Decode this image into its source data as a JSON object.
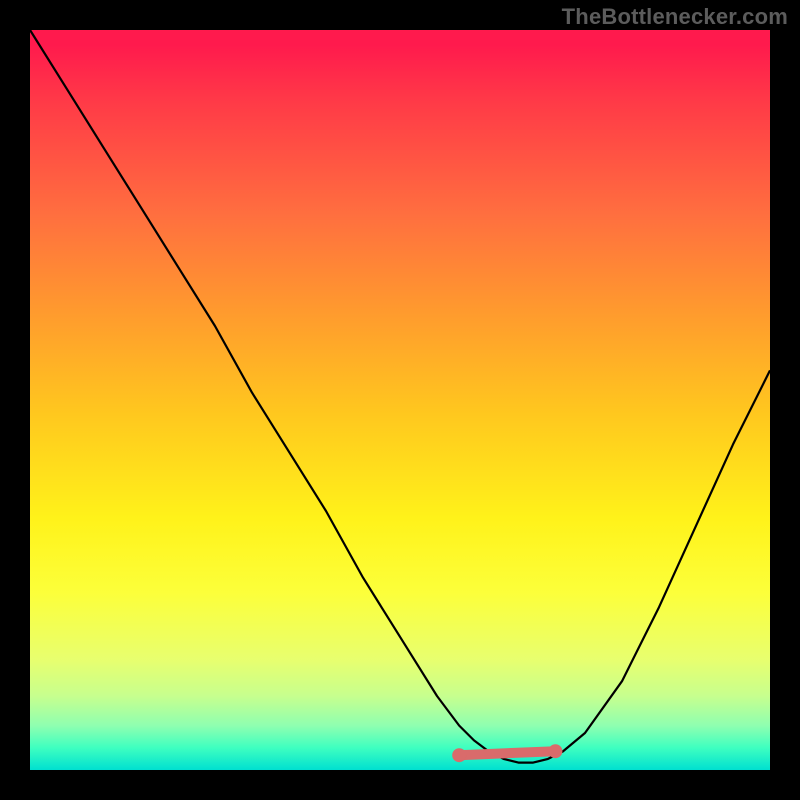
{
  "watermark": "TheBottlenecker.com",
  "chart_data": {
    "type": "line",
    "title": "",
    "xlabel": "",
    "ylabel": "",
    "xlim": [
      0,
      100
    ],
    "ylim": [
      0,
      100
    ],
    "grid": false,
    "legend": false,
    "series": [
      {
        "name": "bottleneck-curve",
        "x": [
          0,
          5,
          10,
          15,
          20,
          25,
          30,
          35,
          40,
          45,
          50,
          55,
          58,
          60,
          62,
          64,
          66,
          68,
          70,
          72,
          75,
          80,
          85,
          90,
          95,
          100
        ],
        "y": [
          100,
          92,
          84,
          76,
          68,
          60,
          51,
          43,
          35,
          26,
          18,
          10,
          6,
          4,
          2.5,
          1.5,
          1,
          1,
          1.5,
          2.5,
          5,
          12,
          22,
          33,
          44,
          54
        ]
      },
      {
        "name": "optimal-range-marker",
        "x": [
          58,
          71
        ],
        "y": [
          2,
          2
        ]
      }
    ],
    "annotations": [],
    "gradient_stops": [
      {
        "pos": 0.0,
        "color": "#ff1a4d"
      },
      {
        "pos": 0.25,
        "color": "#ff6f3f"
      },
      {
        "pos": 0.52,
        "color": "#ffc81e"
      },
      {
        "pos": 0.76,
        "color": "#fcff3a"
      },
      {
        "pos": 0.94,
        "color": "#8fffb0"
      },
      {
        "pos": 1.0,
        "color": "#00e0d0"
      }
    ]
  }
}
